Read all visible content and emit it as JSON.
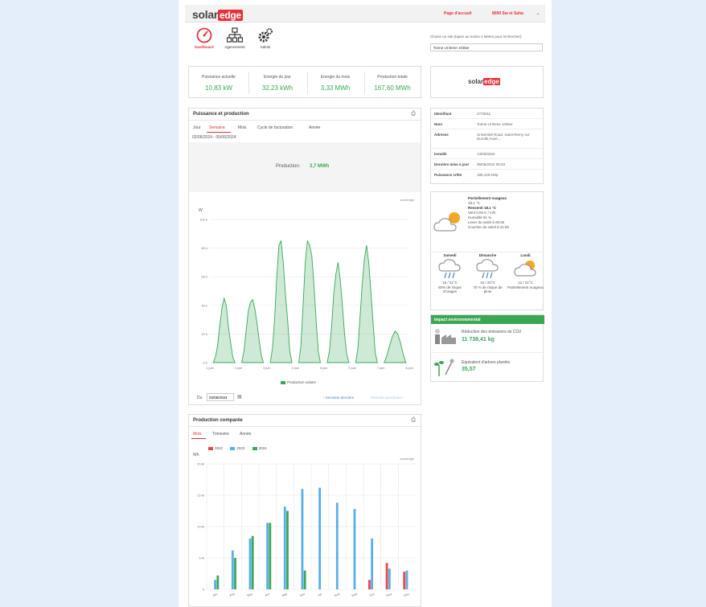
{
  "header": {
    "logo_solar": "solar",
    "logo_edge": "edge",
    "home_link": "Page d'accueil",
    "account_menu": "8090 Sw et Saha"
  },
  "nav": {
    "items": [
      {
        "label": "Dashboard",
        "active": true
      },
      {
        "label": "Agencement",
        "active": false
      },
      {
        "label": "Admin",
        "active": false
      }
    ]
  },
  "search": {
    "label": "Choisir un site (tapez au moins 4 lettres pour rechercher)",
    "value": "Tonne Ut Bene 103ker"
  },
  "stats": [
    {
      "label": "Puissance actuelle",
      "value": "10,83 kW"
    },
    {
      "label": "Energie du jour",
      "value": "32,23 kWh"
    },
    {
      "label": "Energie du mois",
      "value": "3,33 MWh"
    },
    {
      "label": "Production totale",
      "value": "167,60 MWh"
    }
  ],
  "brand_box": {
    "solar": "solar",
    "edge": "edge"
  },
  "power_panel": {
    "title": "Puissance et production",
    "tabs": [
      "Jour",
      "Semaine",
      "Mois",
      "Cycle de facturation",
      "Année"
    ],
    "active_tab": 1,
    "date_range": "02/06/2024 - 05/06/2024",
    "production_label": "Production:",
    "production_value": "3,7 MWh",
    "y_unit": "W",
    "legend": "Production solaire",
    "date_label": "Du",
    "date_value": "02/06/2024",
    "prev_week": "‹ Semaine dernière",
    "next_week": "Semaine prochaine ›",
    "brand": "solaredge",
    "accent": "#3aa757"
  },
  "compare_panel": {
    "title": "Production comparée",
    "tabs": [
      "Mois",
      "Trimestre",
      "Année"
    ],
    "active_tab": 0,
    "y_unit": "Wh",
    "brand": "solaredge"
  },
  "site_info": {
    "rows": [
      {
        "k": "Identifiant",
        "v": "2770011"
      },
      {
        "k": "Nom",
        "v": "Tonne Ut Bene 103ker"
      },
      {
        "k": "Adresse",
        "v": "Université Road, Saint-Remy sur Durolle,Auve..."
      },
      {
        "k": "Installé",
        "v": "14/03/2022"
      },
      {
        "k": "Dernière mise à jour",
        "v": "05/06/2024 09:33"
      },
      {
        "k": "Puissance crête",
        "v": "180,125 kWp"
      }
    ]
  },
  "weather": {
    "now_title": "Partiellement nuageux",
    "now_temp": "18.1 °C",
    "now_feel": "Ressenti 18.1 °C",
    "now_lines": [
      "Vent 0.00 K / m/h",
      "Humidité 81 %",
      "Lever du soleil à 05:55",
      "Coucher du soleil à 21:50"
    ],
    "days": [
      {
        "name": "Samedi",
        "temp": "16 / 21°C",
        "desc": "60% de risque d'orages"
      },
      {
        "name": "Dimanche",
        "temp": "15 / 20°C",
        "desc": "70 % de risque de pluie"
      },
      {
        "name": "Lundi",
        "temp": "12 / 21°C",
        "desc": "Partiellement nuageux"
      }
    ]
  },
  "impact": {
    "title": "Impact environnemental",
    "co2_label": "Réduction des émissions de CO2",
    "co2_value": "11 738,41 kg",
    "trees_label": "Equivalent d'arbres plantés",
    "trees_value": "35,57"
  },
  "chart_data": [
    {
      "type": "area",
      "title": "Puissance et production",
      "ylabel": "W",
      "x": [
        "1 juin",
        "2 juin",
        "3 juin",
        "4 juin",
        "5 juin",
        "6 juin",
        "7 juin",
        "8 juin"
      ],
      "y_ticks": [
        "0 k",
        "20 k",
        "40 k",
        "60 k",
        "80 k",
        "100 k"
      ],
      "ylim": [
        0,
        100000
      ],
      "series": [
        {
          "name": "Production solaire",
          "color": "#3aa757",
          "days": [
            {
              "day": 1,
              "values": [
                0,
                4000,
                12000,
                26000,
                38000,
                45000,
                40000,
                25000,
                14000,
                4000,
                0
              ]
            },
            {
              "day": 2,
              "values": [
                0,
                8000,
                22000,
                36000,
                42000,
                44000,
                38000,
                28000,
                16000,
                5000,
                0
              ]
            },
            {
              "day": 3,
              "values": [
                0,
                10000,
                30000,
                60000,
                82000,
                85000,
                70000,
                48000,
                30000,
                8000,
                0
              ]
            },
            {
              "day": 4,
              "values": [
                0,
                12000,
                40000,
                70000,
                85000,
                82000,
                75000,
                55000,
                30000,
                8000,
                0
              ]
            },
            {
              "day": 5,
              "values": [
                0,
                8000,
                25000,
                48000,
                62000,
                70000,
                58000,
                40000,
                20000,
                6000,
                0
              ]
            },
            {
              "day": 6,
              "values": [
                0,
                10000,
                32000,
                55000,
                72000,
                82000,
                70000,
                50000,
                28000,
                7000,
                0
              ]
            },
            {
              "day": 7,
              "values": [
                0,
                5000,
                12000,
                18000,
                22000,
                20000,
                14000,
                6000,
                0
              ]
            }
          ]
        }
      ],
      "grid": true,
      "legend": "bottom"
    },
    {
      "type": "bar",
      "title": "Production comparée",
      "ylabel": "Wh",
      "categories": [
        "Jan",
        "Fév",
        "Mar",
        "Avr",
        "Mai",
        "Jun",
        "Jul",
        "Aoû",
        "Sep",
        "Oct",
        "Nov",
        "Déc"
      ],
      "y_ticks": [
        "0",
        "5 M",
        "10 M",
        "15 M",
        "20 M"
      ],
      "ylim": [
        0,
        20000000
      ],
      "series": [
        {
          "name": "2022",
          "color": "#e8464b",
          "values": [
            0,
            0,
            0,
            0,
            0,
            0,
            0,
            0,
            0,
            1500000,
            4200000,
            2800000
          ]
        },
        {
          "name": "2023",
          "color": "#5aaee8",
          "values": [
            1500000,
            6200000,
            8100000,
            10600000,
            13200000,
            16000000,
            16200000,
            13800000,
            12800000,
            8100000,
            3300000,
            3000000
          ]
        },
        {
          "name": "2024",
          "color": "#3aa757",
          "values": [
            2200000,
            5000000,
            8500000,
            10600000,
            12500000,
            3000000,
            0,
            0,
            0,
            0,
            0,
            0
          ]
        }
      ],
      "grid": true,
      "legend": "top-left"
    }
  ]
}
